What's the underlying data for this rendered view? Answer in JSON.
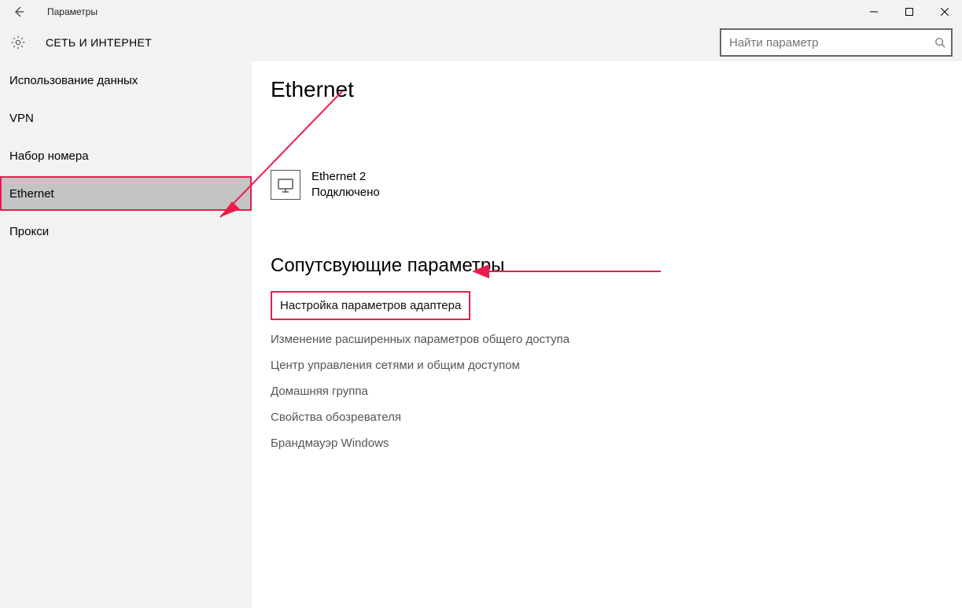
{
  "titlebar": {
    "label": "Параметры"
  },
  "header": {
    "section_title": "СЕТЬ И ИНТЕРНЕТ",
    "search_placeholder": "Найти параметр"
  },
  "sidebar": {
    "items": [
      {
        "label": "Использование данных"
      },
      {
        "label": "VPN"
      },
      {
        "label": "Набор номера"
      },
      {
        "label": "Ethernet",
        "selected": true
      },
      {
        "label": "Прокси"
      }
    ]
  },
  "main": {
    "page_title": "Ethernet",
    "connection": {
      "name": "Ethernet 2",
      "status": "Подключено"
    },
    "related_heading": "Сопутсвующие параметры",
    "related_links": [
      {
        "label": "Настройка параметров адаптера",
        "highlight": true
      },
      {
        "label": "Изменение расширенных параметров общего доступа"
      },
      {
        "label": "Центр управления сетями и общим доступом"
      },
      {
        "label": "Домашняя группа"
      },
      {
        "label": "Свойства обозревателя"
      },
      {
        "label": "Брандмауэр Windows"
      }
    ]
  }
}
